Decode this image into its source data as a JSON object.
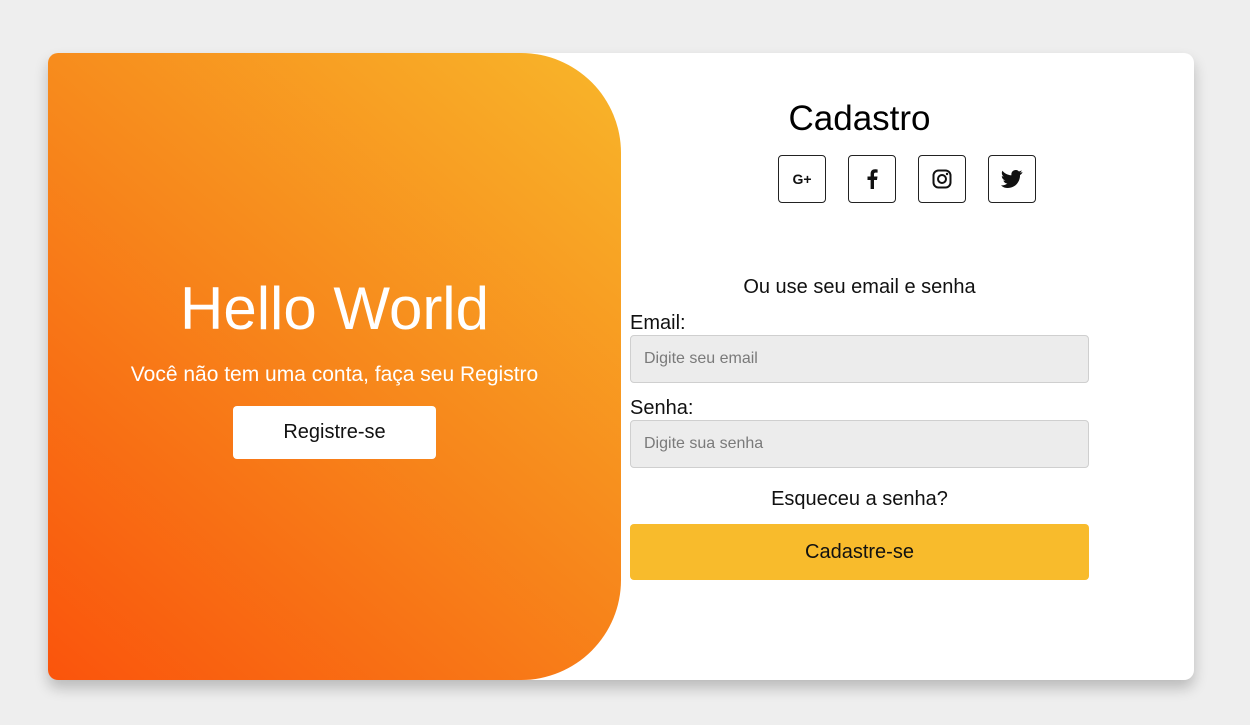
{
  "welcome": {
    "title": "Hello World",
    "subtitle": "Você não tem uma conta, faça seu Registro",
    "register_label": "Registre-se"
  },
  "form": {
    "title": "Cadastro",
    "socials": [
      {
        "icon": "google-plus-icon",
        "label": "G+"
      },
      {
        "icon": "facebook-icon"
      },
      {
        "icon": "instagram-icon"
      },
      {
        "icon": "twitter-icon"
      }
    ],
    "or_text": "Ou use seu email e senha",
    "email_label": "Email:",
    "email_placeholder": "Digite seu email",
    "password_label": "Senha:",
    "password_placeholder": "Digite sua senha",
    "forgot_label": "Esqueceu a senha?",
    "submit_label": "Cadastre-se"
  },
  "colors": {
    "background": "#eeeeee",
    "gradient_start": "#fa540c",
    "gradient_end": "#f8b62a",
    "submit": "#f8bb2c"
  }
}
